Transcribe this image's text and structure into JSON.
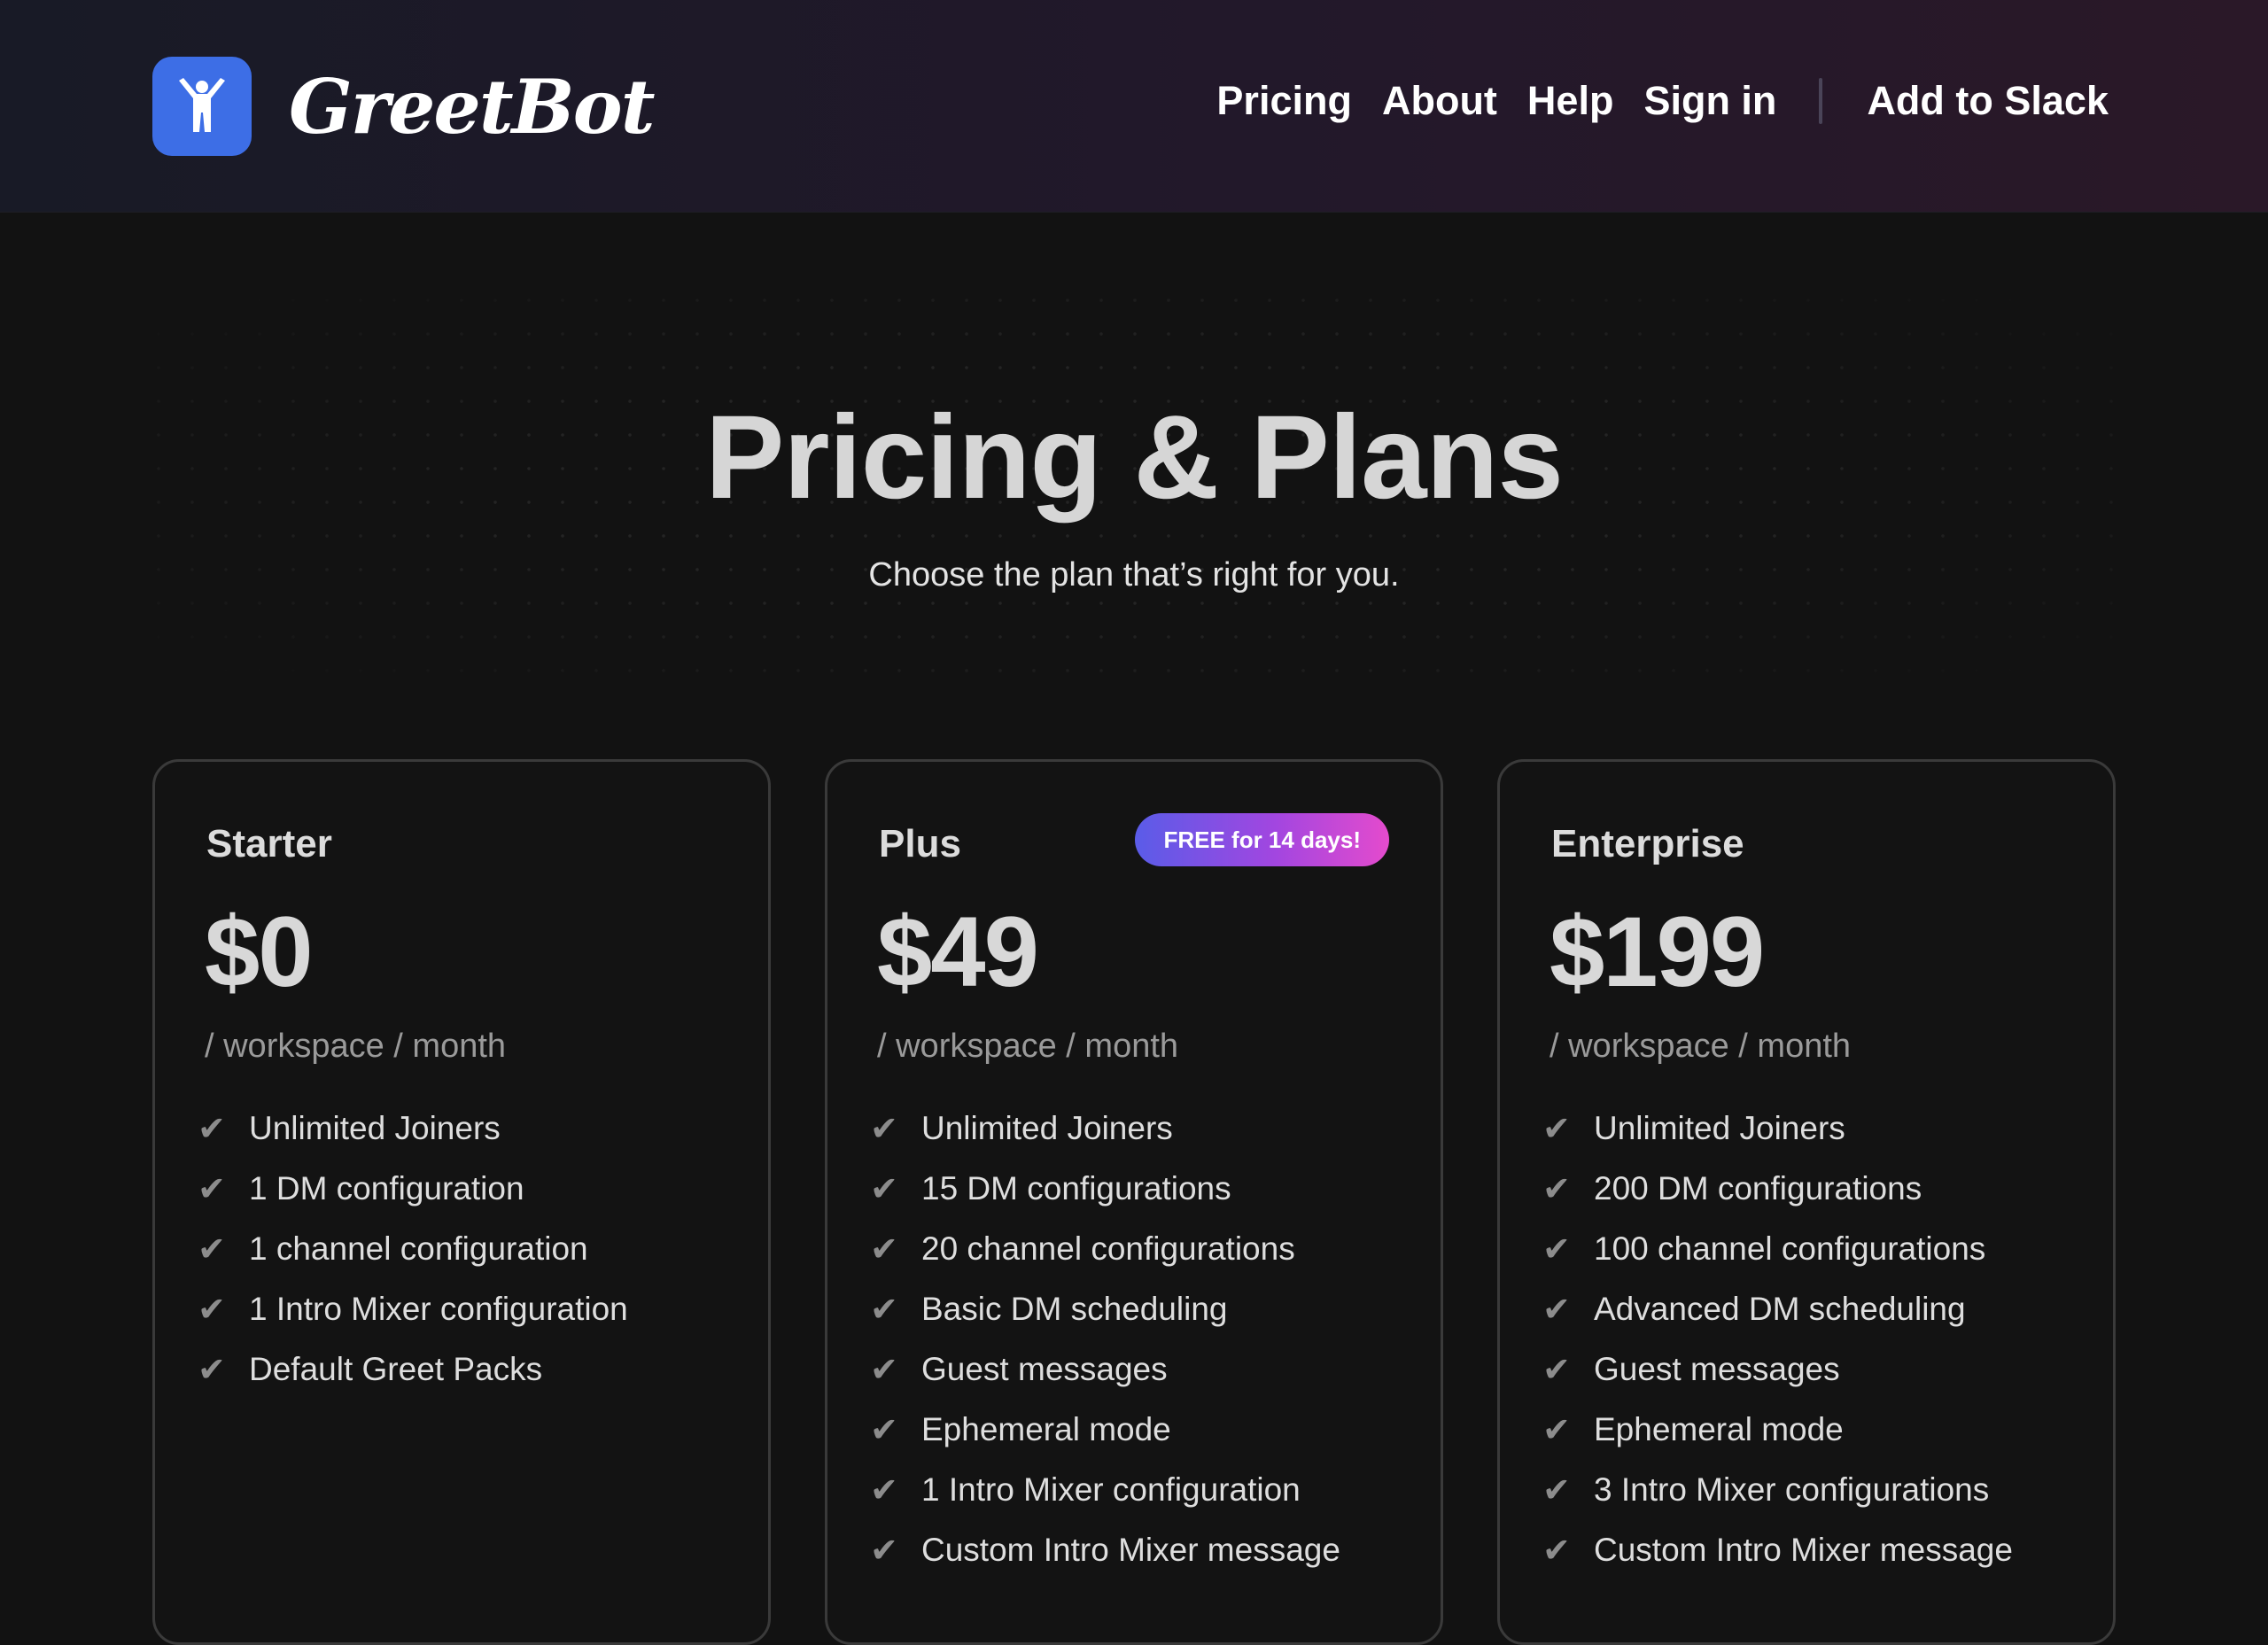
{
  "brand": {
    "name": "GreetBot",
    "logo_icon": "person-arms-raised-icon",
    "logo_color": "#3d6ee6"
  },
  "nav": {
    "items": [
      "Pricing",
      "About",
      "Help",
      "Sign in"
    ],
    "cta": "Add to Slack"
  },
  "hero": {
    "title": "Pricing & Plans",
    "subtitle": "Choose the plan that’s right for you."
  },
  "plans": [
    {
      "name": "Starter",
      "price": "$0",
      "period": "/ workspace / month",
      "features": [
        "Unlimited Joiners",
        "1 DM configuration",
        "1 channel configuration",
        "1 Intro Mixer configuration",
        "Default Greet Packs"
      ]
    },
    {
      "name": "Plus",
      "badge": "FREE for 14 days!",
      "price": "$49",
      "period": "/ workspace / month",
      "features": [
        "Unlimited Joiners",
        "15 DM configurations",
        "20 channel configurations",
        "Basic DM scheduling",
        "Guest messages",
        "Ephemeral mode",
        "1 Intro Mixer configuration",
        "Custom Intro Mixer message"
      ]
    },
    {
      "name": "Enterprise",
      "price": "$199",
      "period": "/ workspace / month",
      "features": [
        "Unlimited Joiners",
        "200 DM configurations",
        "100 channel configurations",
        "Advanced DM scheduling",
        "Guest messages",
        "Ephemeral mode",
        "3 Intro Mixer configurations",
        "Custom Intro Mixer message"
      ]
    }
  ],
  "check_glyph": "✔"
}
